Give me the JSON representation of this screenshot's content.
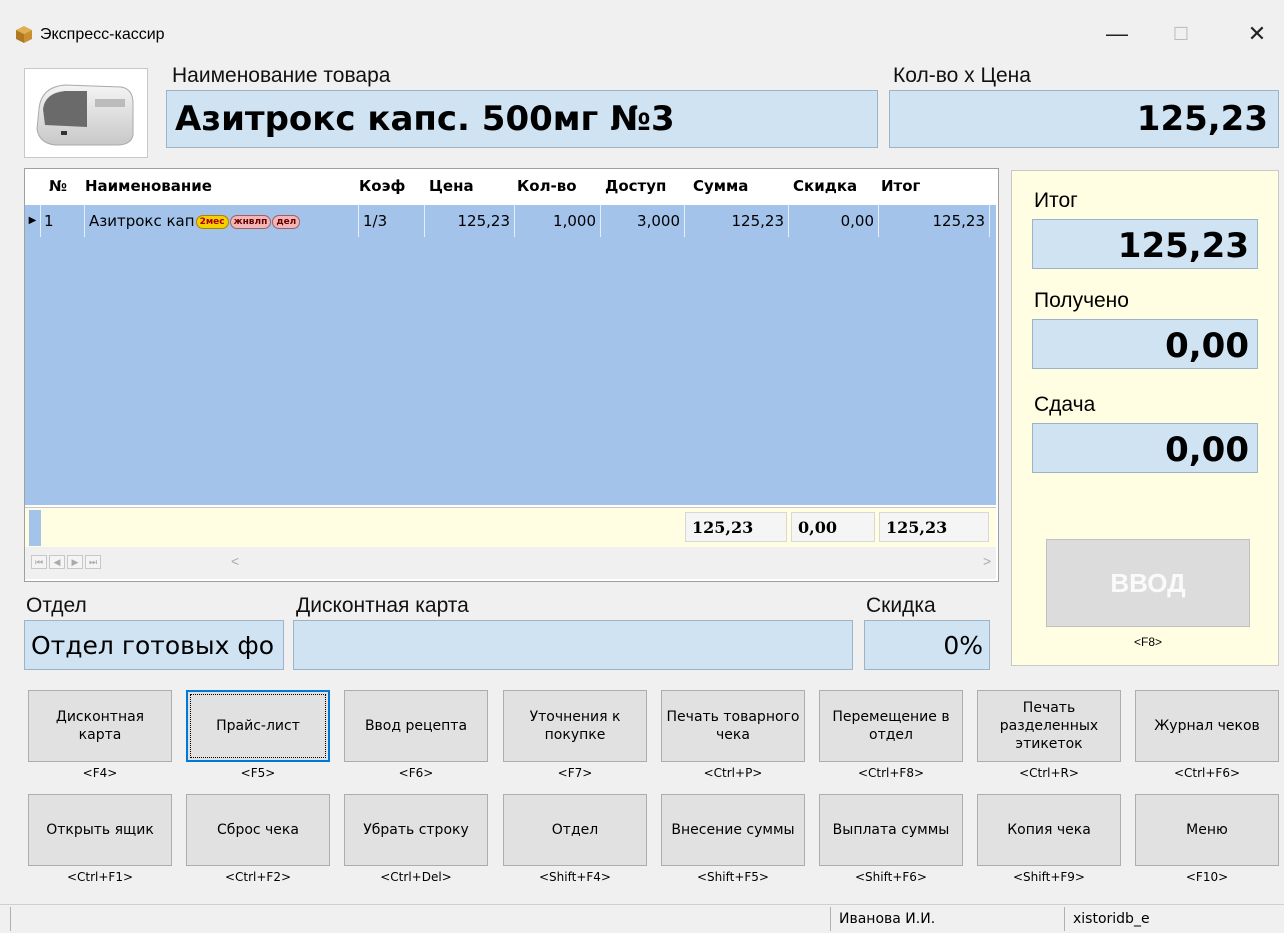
{
  "window": {
    "title": "Экспресс-кассир",
    "minimize_label": "—",
    "maximize_label": "☐",
    "close_label": "✕"
  },
  "header": {
    "product_caption": "Наименование товара",
    "product_name": "Азитрокс капс. 500мг №3",
    "qty_price_caption": "Кол-во х Цена",
    "qty_price_value": "125,23"
  },
  "grid": {
    "columns": [
      "№",
      "Наименование",
      "Коэф",
      "Цена",
      "Кол-во",
      "Доступ",
      "Сумма",
      "Скидка",
      "Итог"
    ],
    "rows": [
      {
        "num": "1",
        "name": "Азитрокс кап",
        "badges": [
          "2мес",
          "жнвлп",
          "дел"
        ],
        "coef": "1/3",
        "price": "125,23",
        "qty": "1,000",
        "avail": "3,000",
        "sum": "125,23",
        "discount": "0,00",
        "total": "125,23"
      }
    ],
    "footer": {
      "sum": "125,23",
      "discount": "0,00",
      "total": "125,23"
    },
    "nav": {
      "first": "⏮",
      "prev": "◀",
      "next": "▶",
      "last": "⏭",
      "scroll_left": "<",
      "scroll_right": ">"
    }
  },
  "totals": {
    "total_caption": "Итог",
    "total_value": "125,23",
    "received_caption": "Получено",
    "received_value": "0,00",
    "change_caption": "Сдача",
    "change_value": "0,00",
    "enter_label": "ВВОД",
    "enter_key": "<F8>"
  },
  "bottom_fields": {
    "dept_caption": "Отдел",
    "dept_value": "Отдел готовых фо",
    "card_caption": "Дисконтная карта",
    "card_value": "",
    "discount_caption": "Скидка",
    "discount_value": "0%"
  },
  "buttons_row1": [
    {
      "label": "Дисконтная карта",
      "key": "<F4>"
    },
    {
      "label": "Прайс-лист",
      "key": "<F5>"
    },
    {
      "label": "Ввод рецепта",
      "key": "<F6>"
    },
    {
      "label": "Уточнения к покупке",
      "key": "<F7>"
    },
    {
      "label": "Печать товарного чека",
      "key": "<Ctrl+P>"
    },
    {
      "label": "Перемещение в отдел",
      "key": "<Ctrl+F8>"
    },
    {
      "label": "Печать разделенных этикеток",
      "key": "<Ctrl+R>"
    },
    {
      "label": "Журнал чеков",
      "key": "<Ctrl+F6>"
    }
  ],
  "buttons_row2": [
    {
      "label": "Открыть ящик",
      "key": "<Ctrl+F1>"
    },
    {
      "label": "Сброс чека",
      "key": "<Ctrl+F2>"
    },
    {
      "label": "Убрать строку",
      "key": "<Ctrl+Del>"
    },
    {
      "label": "Отдел",
      "key": "<Shift+F4>"
    },
    {
      "label": "Внесение суммы",
      "key": "<Shift+F5>"
    },
    {
      "label": "Выплата суммы",
      "key": "<Shift+F6>"
    },
    {
      "label": "Копия чека",
      "key": "<Shift+F9>"
    },
    {
      "label": "Меню",
      "key": "<F10>"
    }
  ],
  "status": {
    "panel1": "",
    "user": "Иванова И.И.",
    "db": "xistoridb_e"
  },
  "colors": {
    "grid_bg": "#a3c3ea",
    "field_bg": "#cfe3f3",
    "panel_bg": "#fffde2",
    "badge_yellow": "#f5d000",
    "badge_pink": "#f3b6b6"
  }
}
